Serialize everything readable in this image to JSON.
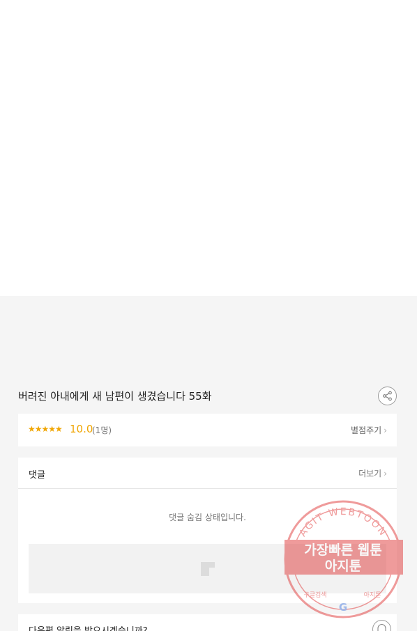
{
  "episode": {
    "title": "버려진 아내에게 새 남편이 생겼습니다 55화"
  },
  "rating": {
    "stars": "★★★★★",
    "score": "10.0",
    "count": "(1명)",
    "rate_label": "별점주기",
    "chevron": "›"
  },
  "comments": {
    "title": "댓글",
    "more_label": "더보기",
    "chevron": "›",
    "hidden_message": "댓글 숨김 상태입니다."
  },
  "notify": {
    "text": "다음편 알림을 받으시겠습니까?"
  },
  "watermark": {
    "arc_text": "AGIT WEBTOON",
    "line1": "가장빠른 웹툰",
    "line2": "아지툰",
    "bottom_left": "구글검색",
    "bottom_right": "아지툰",
    "logo": "G"
  },
  "colors": {
    "accent": "#f0a500",
    "background": "#f5f5f5",
    "stamp": "#e03a3a"
  },
  "icons": {
    "share": "share-icon",
    "comment_placeholder": "image-placeholder-icon",
    "notify": "bell-icon"
  }
}
